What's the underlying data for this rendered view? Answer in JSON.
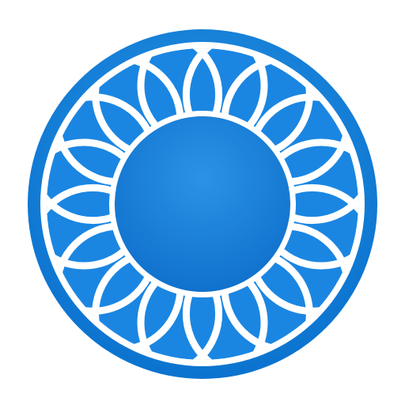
{
  "icon": {
    "name": "rosette-logo-icon",
    "colors": {
      "background": "#ffffff",
      "outer_ring_light": "#2E9BEA",
      "outer_ring_dark": "#0B73CF",
      "lattice_fill": "#1A86E2",
      "lattice_lines": "#ffffff",
      "center_light": "#2A93E6",
      "center_dark": "#0E6FCB"
    }
  }
}
